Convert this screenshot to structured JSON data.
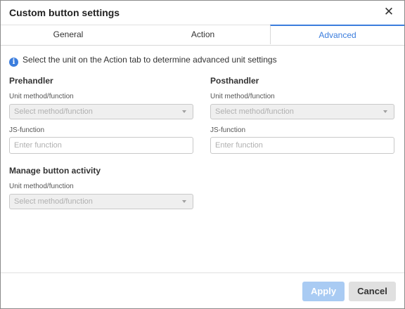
{
  "dialog": {
    "title": "Custom button settings",
    "close_icon": "close-icon"
  },
  "tabs": [
    {
      "label": "General"
    },
    {
      "label": "Action"
    },
    {
      "label": "Advanced",
      "active": true
    }
  ],
  "info": {
    "icon": "info-icon",
    "text": "Select the unit on the Action tab to determine advanced unit settings"
  },
  "prehandler": {
    "title": "Prehandler",
    "method_label": "Unit method/function",
    "method_placeholder": "Select method/function",
    "js_label": "JS-function",
    "js_placeholder": "Enter function"
  },
  "posthandler": {
    "title": "Posthandler",
    "method_label": "Unit method/function",
    "method_placeholder": "Select method/function",
    "js_label": "JS-function",
    "js_placeholder": "Enter function"
  },
  "activity": {
    "title": "Manage button activity",
    "method_label": "Unit method/function",
    "method_placeholder": "Select method/function"
  },
  "footer": {
    "apply_label": "Apply",
    "cancel_label": "Cancel"
  },
  "colors": {
    "accent": "#3b7ddd",
    "apply_disabled": "#a9cbf3"
  }
}
